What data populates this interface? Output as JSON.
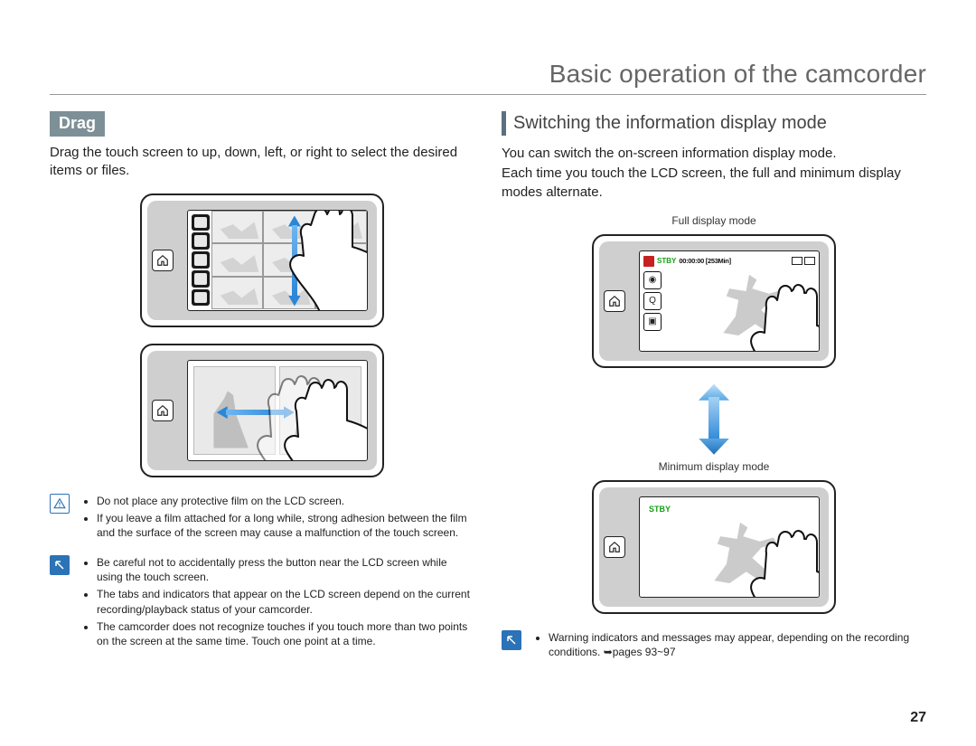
{
  "page_title": "Basic operation of the camcorder",
  "page_number": "27",
  "left": {
    "drag_label": "Drag",
    "drag_body": "Drag the touch screen to up, down, left, or right to select the desired items or files.",
    "warning_items": [
      "Do not place any protective film on the LCD screen.",
      "If you leave a film attached for a long while, strong adhesion between the film and the surface of the screen may cause a malfunction of the touch screen."
    ],
    "info_items": [
      "Be careful not to accidentally press the button near the LCD screen while using the touch screen.",
      "The tabs and indicators that appear on the LCD screen depend on the current recording/playback status of your camcorder.",
      "The camcorder does not recognize touches if you touch more than two points on the screen at the same time. Touch one point at a time."
    ]
  },
  "right": {
    "heading": "Switching the information display mode",
    "body1": "You can switch the on-screen information display mode.",
    "body2": "Each time you touch the LCD screen, the full and minimum display modes alternate.",
    "caption_full": "Full display mode",
    "caption_min": "Minimum display mode",
    "osd_stby": "STBY",
    "osd_time": "00:00:00 [253Min]",
    "info_items": [
      "Warning indicators and messages may appear, depending on the recording conditions. ➥pages 93~97"
    ]
  }
}
